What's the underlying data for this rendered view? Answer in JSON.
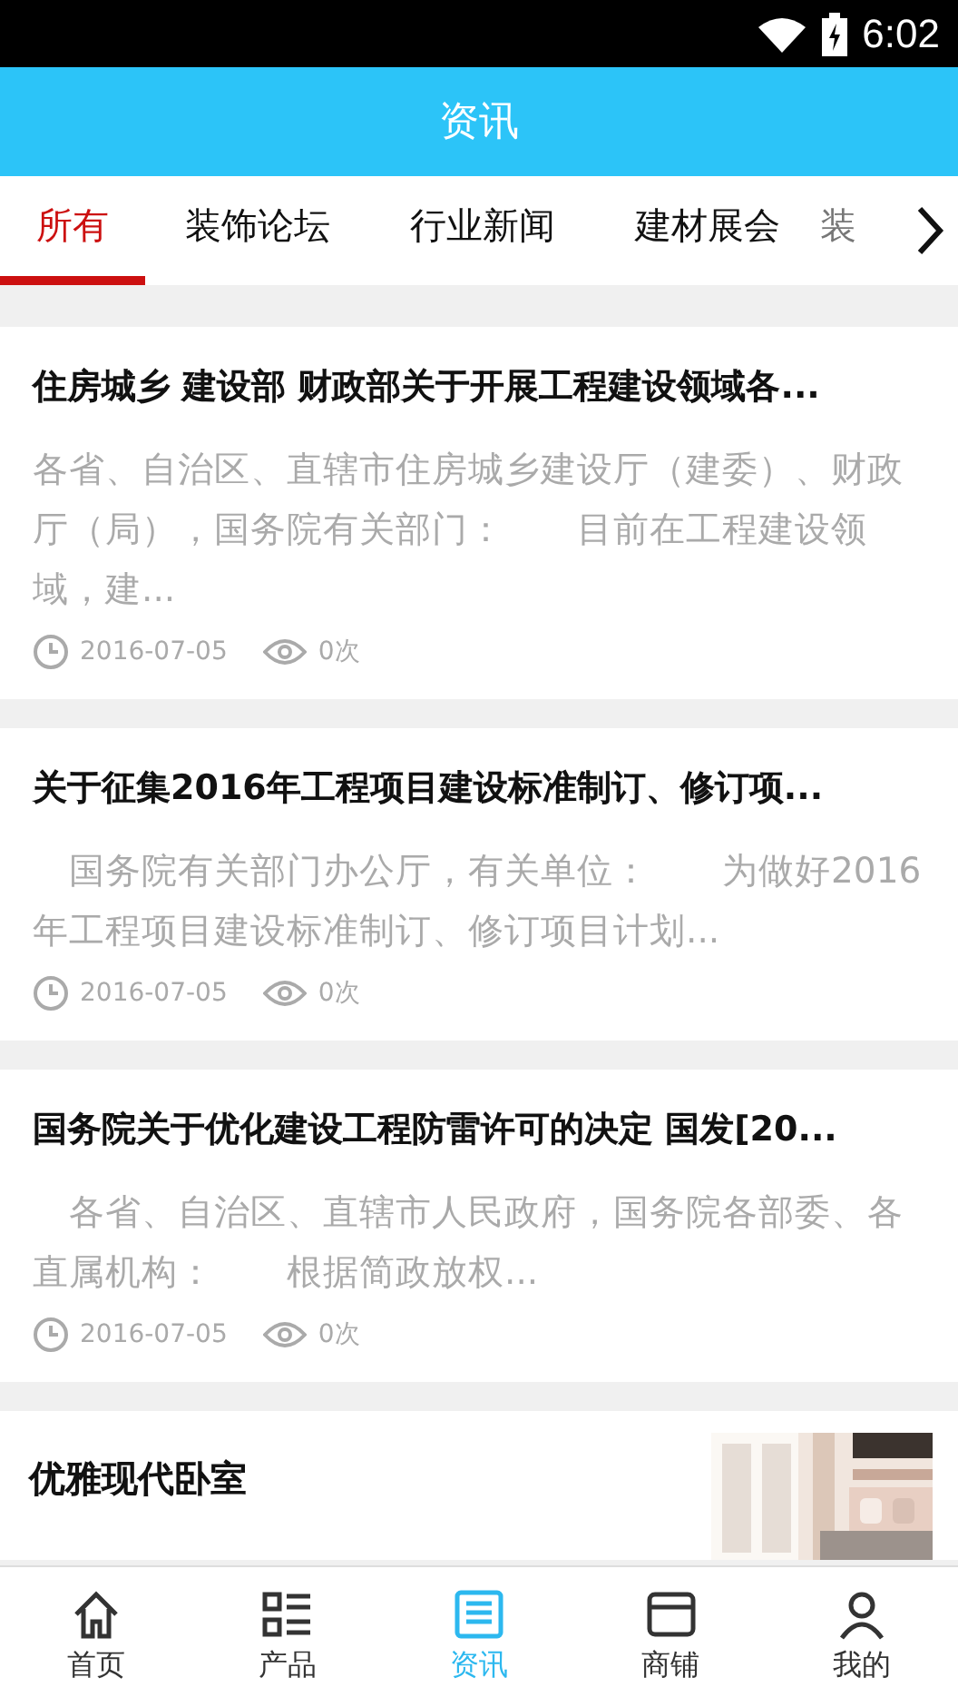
{
  "status_bar": {
    "time": "6:02"
  },
  "header": {
    "title": "资讯"
  },
  "tabs": [
    {
      "label": "所有",
      "selected": true
    },
    {
      "label": "装饰论坛",
      "selected": false
    },
    {
      "label": "行业新闻",
      "selected": false
    },
    {
      "label": "建材展会",
      "selected": false
    },
    {
      "label": "装",
      "selected": false
    }
  ],
  "articles": [
    {
      "kind": "text",
      "title": "住房城乡 建设部 财政部关于开展工程建设领域各...",
      "summary": "各省、自治区、直辖市住房城乡建设厅（建委）、财政厅（局），国务院有关部门：　　目前在工程建设领域，建...",
      "date": "2016-07-05",
      "views": "0次"
    },
    {
      "kind": "text",
      "title": "关于征集2016年工程项目建设标准制订、修订项...",
      "summary": "　国务院有关部门办公厅，有关单位：　　为做好2016年工程项目建设标准制订、修订项目计划...",
      "date": "2016-07-05",
      "views": "0次"
    },
    {
      "kind": "text",
      "title": "国务院关于优化建设工程防雷许可的决定 国发[20...",
      "summary": "　各省、自治区、直辖市人民政府，国务院各部委、各直属机构：　　根据简政放权...",
      "date": "2016-07-05",
      "views": "0次"
    },
    {
      "kind": "picture",
      "title": "优雅现代卧室"
    }
  ],
  "bottom_nav": [
    {
      "label": "首页",
      "kind": "home",
      "selected": false
    },
    {
      "label": "产品",
      "kind": "list",
      "selected": false
    },
    {
      "label": "资讯",
      "kind": "news",
      "selected": true
    },
    {
      "label": "商铺",
      "kind": "shop",
      "selected": false
    },
    {
      "label": "我的",
      "kind": "user",
      "selected": false
    }
  ]
}
